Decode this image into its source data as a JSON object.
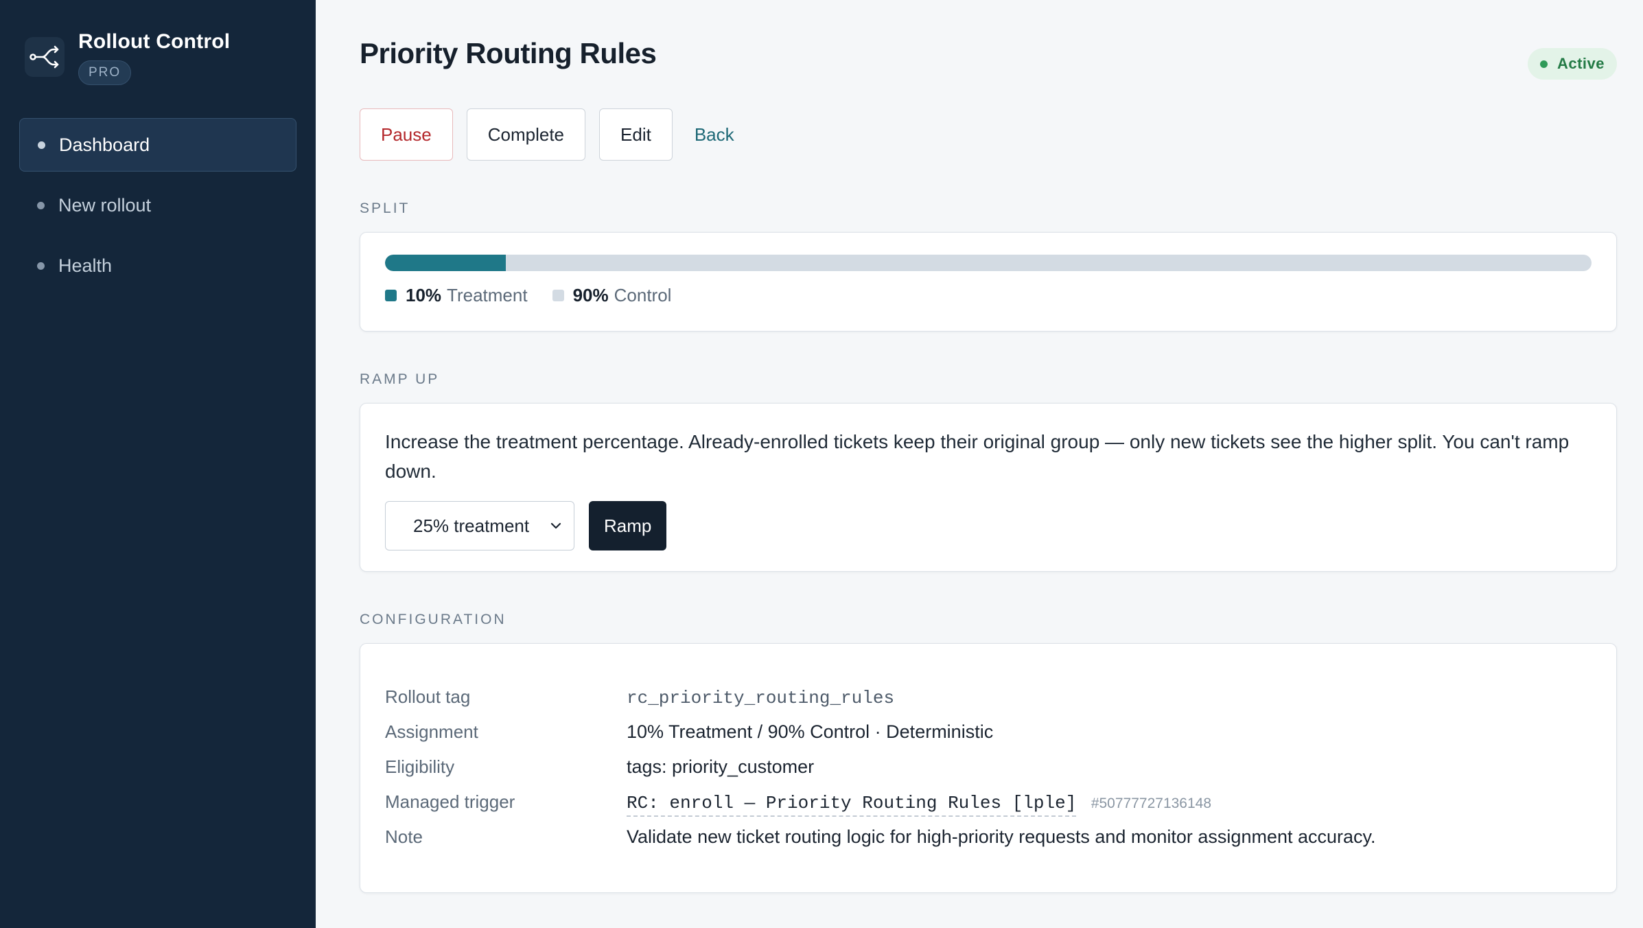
{
  "app": {
    "title": "Rollout Control",
    "badge": "PRO"
  },
  "sidebar": {
    "items": [
      {
        "label": "Dashboard",
        "active": true
      },
      {
        "label": "New rollout",
        "active": false
      },
      {
        "label": "Health",
        "active": false
      }
    ]
  },
  "header": {
    "title": "Priority Routing Rules",
    "status": "Active"
  },
  "actions": {
    "pause": "Pause",
    "complete": "Complete",
    "edit": "Edit",
    "back": "Back"
  },
  "split": {
    "label": "SPLIT",
    "treatment_pct": 10,
    "treatment_pct_label": "10%",
    "treatment_name": "Treatment",
    "control_pct_label": "90%",
    "control_name": "Control",
    "colors": {
      "treatment": "#1f7888",
      "control": "#d3dbe3"
    }
  },
  "ramp": {
    "label": "RAMP UP",
    "description": "Increase the treatment percentage. Already-enrolled tickets keep their original group — only new tickets see the higher split. You can't ramp down.",
    "selected_option": "25% treatment",
    "button": "Ramp"
  },
  "config": {
    "label": "CONFIGURATION",
    "rows": {
      "tag": {
        "label": "Rollout tag",
        "value": "rc_priority_routing_rules"
      },
      "assignment": {
        "label": "Assignment",
        "value": "10% Treatment / 90% Control · Deterministic"
      },
      "eligibility": {
        "label": "Eligibility",
        "value": "tags: priority_customer"
      },
      "trigger": {
        "label": "Managed trigger",
        "value": "RC: enroll — Priority Routing Rules [lple]",
        "id": "#50777727136148"
      },
      "note": {
        "label": "Note",
        "value": "Validate new ticket routing logic for high-priority requests and monitor assignment accuracy."
      }
    }
  }
}
